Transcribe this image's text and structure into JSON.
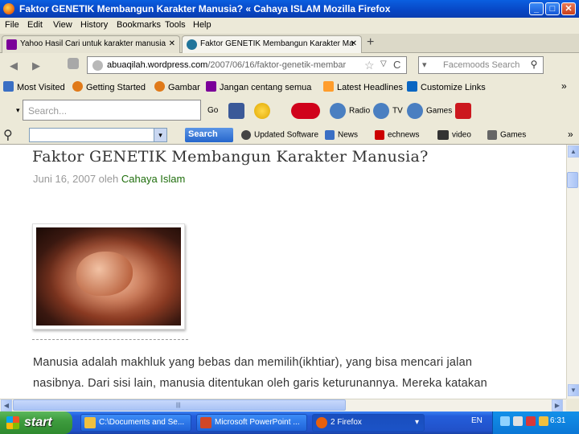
{
  "window": {
    "title": "Faktor GENETIK Membangun Karakter Manusia? « Cahaya ISLAM - Mozilla Firefox",
    "title_display": "Faktor GENETIK Membangun Karakter Manusia? « Cahaya ISLAM   Mozilla Firefox",
    "minimize": "_",
    "maximize": "□",
    "close": "✕"
  },
  "menu": {
    "items": [
      "File",
      "Edit",
      "View",
      "History",
      "Bookmarks",
      "Tools",
      "Help"
    ]
  },
  "tabs": {
    "items": [
      {
        "label": "Yahoo  Hasil Cari untuk karakter manusia",
        "icon": "yahoo-icon"
      },
      {
        "label": "Faktor GENETIK Membangun Karakter Ma",
        "icon": "wordpress-icon"
      }
    ],
    "close": "✕",
    "new_tab": "+"
  },
  "nav": {
    "back": "◀",
    "forward": "▶",
    "url_prefix": "",
    "url_domain": "abuaqilah.wordpress.com",
    "url_path": "/2007/06/16/faktor-genetik-membar",
    "star": "☆",
    "dropdown": "▽",
    "reload": "C",
    "search_placeholder": "Facemoods Search",
    "search_engine": "▾"
  },
  "bookmarks": {
    "items": [
      {
        "label": "Most Visited",
        "color": "#3a6fc4"
      },
      {
        "label": "Getting Started",
        "color": "#e07a1a"
      },
      {
        "label": "Gambar",
        "color": "#e07a1a"
      },
      {
        "label": "Jangan centang semua",
        "color": "#7b0099"
      },
      {
        "label": "Latest Headlines",
        "color": "#ff9d2c"
      },
      {
        "label": "Customize Links",
        "color": "#0a66c2"
      }
    ],
    "more": "»"
  },
  "toolbar1": {
    "search_placeholder": "Search...",
    "go_label": "Go",
    "radio_label": "Radio",
    "tv_label": "TV",
    "games_label": "Games",
    "vday_label": "V-Day"
  },
  "toolbar2": {
    "search_button": "Search",
    "updated_software": "Updated Software",
    "news": "News",
    "technews": "echnews",
    "video": "video",
    "games": "Games",
    "more": "»"
  },
  "page": {
    "title": "Faktor GENETIK Membangun Karakter Manusia?",
    "meta_date": "Juni 16, 2007 oleh ",
    "meta_author": "Cahaya Islam",
    "para_line1": "Manusia adalah makhluk yang bebas dan memilih(ikhtiar), yang bisa mencari jalan",
    "para_line2": "nasibnya. Dari sisi lain, manusia ditentukan oleh garis keturunannya. Mereka katakan"
  },
  "taskbar": {
    "start": "start",
    "tasks": [
      {
        "label": "C:\\Documents and Se...",
        "color": "#f0c040"
      },
      {
        "label": "Microsoft PowerPoint ...",
        "color": "#d24726"
      },
      {
        "label": "2 Firefox",
        "color": "#e8600c"
      }
    ],
    "task_dropdown": "▾",
    "lang": "EN",
    "clock": "6:31"
  }
}
